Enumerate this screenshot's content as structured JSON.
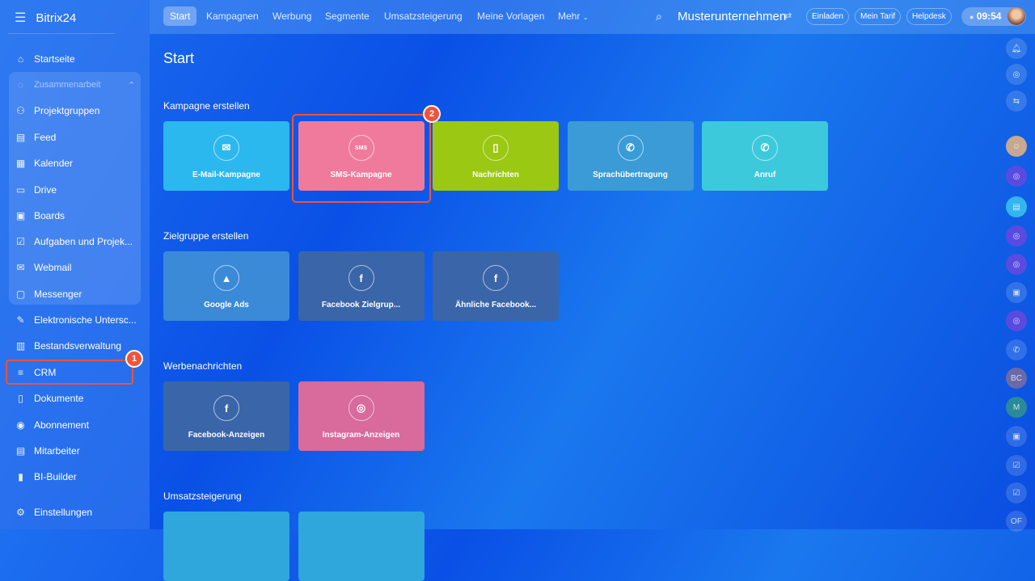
{
  "sidebar": {
    "logo": "Bitrix24",
    "items": [
      {
        "label": "Startseite",
        "icon": "home-icon"
      },
      {
        "label": "Zusammenarbeit",
        "icon": "collab-icon"
      },
      {
        "label": "Projektgruppen",
        "icon": "groups-icon"
      },
      {
        "label": "Feed",
        "icon": "feed-icon"
      },
      {
        "label": "Kalender",
        "icon": "calendar-icon"
      },
      {
        "label": "Drive",
        "icon": "drive-icon"
      },
      {
        "label": "Boards",
        "icon": "boards-icon"
      },
      {
        "label": "Aufgaben und Projek...",
        "icon": "tasks-icon"
      },
      {
        "label": "Webmail",
        "icon": "mail-icon"
      },
      {
        "label": "Messenger",
        "icon": "chat-icon"
      },
      {
        "label": "Elektronische Untersc...",
        "icon": "sign-icon"
      },
      {
        "label": "Bestandsverwaltung",
        "icon": "inventory-icon"
      },
      {
        "label": "CRM",
        "icon": "crm-icon"
      },
      {
        "label": "Dokumente",
        "icon": "documents-icon"
      },
      {
        "label": "Abonnement",
        "icon": "subscription-icon"
      },
      {
        "label": "Mitarbeiter",
        "icon": "employees-icon"
      },
      {
        "label": "BI-Builder",
        "icon": "chart-icon"
      },
      {
        "label": "Einstellungen",
        "icon": "settings-icon"
      }
    ]
  },
  "topbar": {
    "tabs": [
      "Start",
      "Kampagnen",
      "Werbung",
      "Segmente",
      "Umsatzsteigerung",
      "Meine Vorlagen",
      "Mehr"
    ],
    "company": "Musterunternehmen",
    "buttons": [
      "Einladen",
      "Mein Tarif",
      "Helpdesk"
    ],
    "time": "09:54"
  },
  "page": {
    "title": "Start",
    "sections": [
      {
        "title": "Kampagne erstellen",
        "cards": [
          {
            "label": "E-Mail-Kampagne",
            "glyph": "✉",
            "color": "#2bb8ee"
          },
          {
            "label": "SMS-Kampagne",
            "glyph": "SMS",
            "color": "#f07a9c"
          },
          {
            "label": "Nachrichten",
            "glyph": "▯",
            "color": "#9bc813"
          },
          {
            "label": "Sprachübertragung",
            "glyph": "✆",
            "color": "#3a9bd6"
          },
          {
            "label": "Anruf",
            "glyph": "✆",
            "color": "#3dc9dc"
          }
        ]
      },
      {
        "title": "Zielgruppe erstellen",
        "cards": [
          {
            "label": "Google Ads",
            "glyph": "▲",
            "color": "#3a8ad8"
          },
          {
            "label": "Facebook Zielgrup...",
            "glyph": "f",
            "color": "#3a65a8"
          },
          {
            "label": "Ähnliche Facebook...",
            "glyph": "f",
            "color": "#3a65a8"
          }
        ]
      },
      {
        "title": "Werbenachrichten",
        "cards": [
          {
            "label": "Facebook-Anzeigen",
            "glyph": "f",
            "color": "#3a65a8"
          },
          {
            "label": "Instagram-Anzeigen",
            "glyph": "◎",
            "color": "#d86a9c"
          }
        ]
      },
      {
        "title": "Umsatzsteigerung",
        "cards": [
          {
            "label": "",
            "glyph": "",
            "color": "#2fa6dc"
          },
          {
            "label": "",
            "glyph": "",
            "color": "#2fa6dc"
          }
        ]
      }
    ]
  },
  "annotations": [
    "1",
    "2"
  ],
  "rail": [
    "bell",
    "pulse",
    "sync",
    "avatar",
    "open-channel",
    "chat",
    "open-channel",
    "open-channel",
    "contact",
    "open-channel",
    "phone",
    "BC",
    "M",
    "contact",
    "task",
    "task",
    "OF"
  ]
}
